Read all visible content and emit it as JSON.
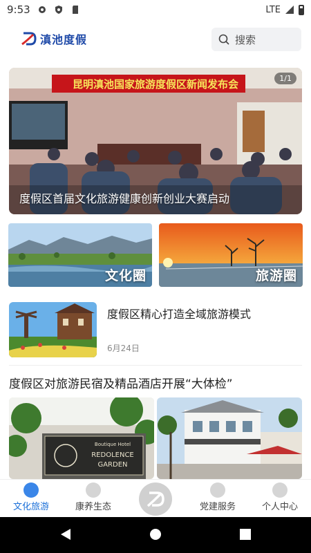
{
  "status_bar": {
    "time": "9:53",
    "network": "LTE"
  },
  "header": {
    "logo_text": "滇池度假",
    "search": {
      "placeholder": "搜索",
      "icon": "search-icon"
    }
  },
  "hero": {
    "banner_text": "昆明滇池国家旅游度假区新闻发布会",
    "caption": "度假区首届文化旅游健康创新创业大赛启动",
    "pager": "1/1"
  },
  "cards": [
    {
      "label": "文化圈"
    },
    {
      "label": "旅游圈"
    }
  ],
  "news_item": {
    "title": "度假区精心打造全域旅游模式",
    "date": "6月24日"
  },
  "feature": {
    "title": "度假区对旅游民宿及精品酒店开展“大体检”",
    "hotel_sign": {
      "small": "Boutique Hotel",
      "name_line1": "REDOLENCE",
      "name_line2": "GARDEN"
    }
  },
  "tabbar": {
    "tabs": [
      {
        "label": "文化旅游",
        "icon": "culture-tourism-icon",
        "active": true
      },
      {
        "label": "康养生态",
        "icon": "wellness-icon",
        "active": false
      },
      {
        "label": "党建服务",
        "icon": "party-service-icon",
        "active": false
      },
      {
        "label": "个人中心",
        "icon": "user-icon",
        "active": false
      }
    ]
  },
  "colors": {
    "accent": "#1a6fd8",
    "logo_blue": "#1f4aa8",
    "logo_red": "#d82b2b"
  }
}
